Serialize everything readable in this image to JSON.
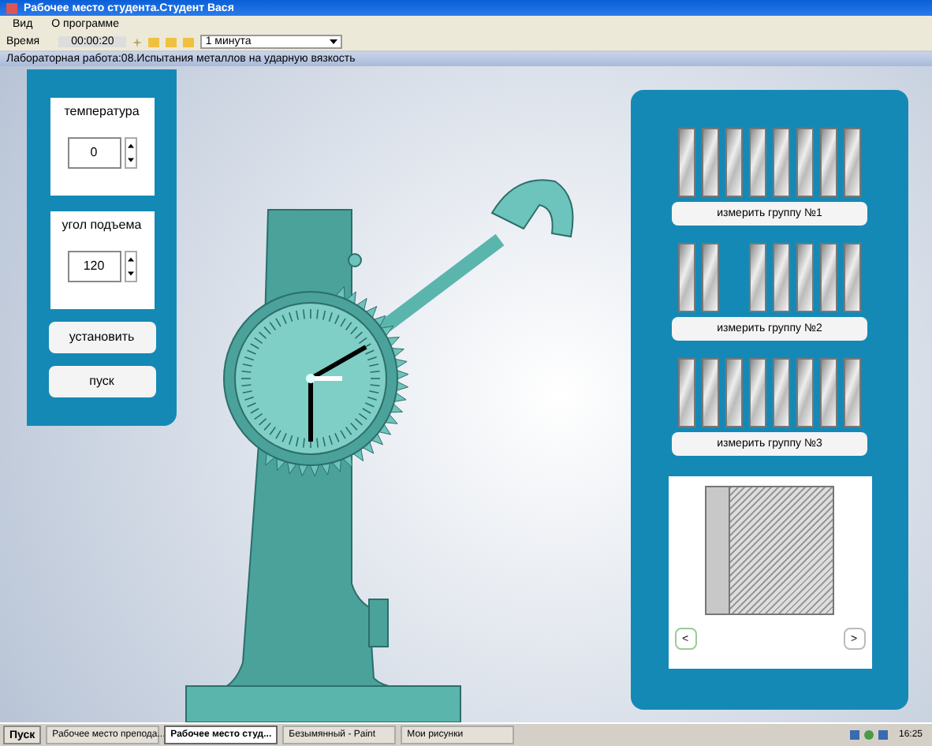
{
  "window": {
    "title": "Рабочее место студента.Студент Вася"
  },
  "menu": [
    "Вид",
    "О программе"
  ],
  "toolbar": {
    "time_label": "Время",
    "time_value": "00:00:20",
    "interval": "1 минута"
  },
  "info_bar": "Лабораторная работа:08.Испытания металлов на ударную вязкость",
  "controls": {
    "fields": [
      {
        "label": "температура",
        "value": "0"
      },
      {
        "label": "угол подъема",
        "value": "120"
      }
    ],
    "buttons": [
      "установить",
      "пуск"
    ]
  },
  "groups": [
    {
      "button": "измерить группу №1",
      "specimens": [
        {
          "present": true
        },
        {
          "present": true
        },
        {
          "present": true
        },
        {
          "present": true
        },
        {
          "present": true
        },
        {
          "present": true
        },
        {
          "present": true
        },
        {
          "present": true
        }
      ]
    },
    {
      "button": "измерить группу №2",
      "specimens": [
        {
          "present": true
        },
        {
          "present": true
        },
        {
          "present": false
        },
        {
          "present": true
        },
        {
          "present": true
        },
        {
          "present": true
        },
        {
          "present": true
        },
        {
          "present": true
        }
      ]
    },
    {
      "button": "измерить группу №3",
      "specimens": [
        {
          "present": true
        },
        {
          "present": true
        },
        {
          "present": true
        },
        {
          "present": true
        },
        {
          "present": true
        },
        {
          "present": true
        },
        {
          "present": true
        },
        {
          "present": true
        }
      ]
    }
  ],
  "preview": {
    "prev": "<",
    "next": ">"
  },
  "taskbar": {
    "start": "Пуск",
    "tasks": [
      {
        "label": "Рабочее место препода...",
        "selected": false
      },
      {
        "label": "Рабочее место студ...",
        "selected": true
      },
      {
        "label": "Безымянный - Paint",
        "selected": false
      },
      {
        "label": "Мои рисунки",
        "selected": false
      }
    ],
    "clock": "16:25"
  }
}
